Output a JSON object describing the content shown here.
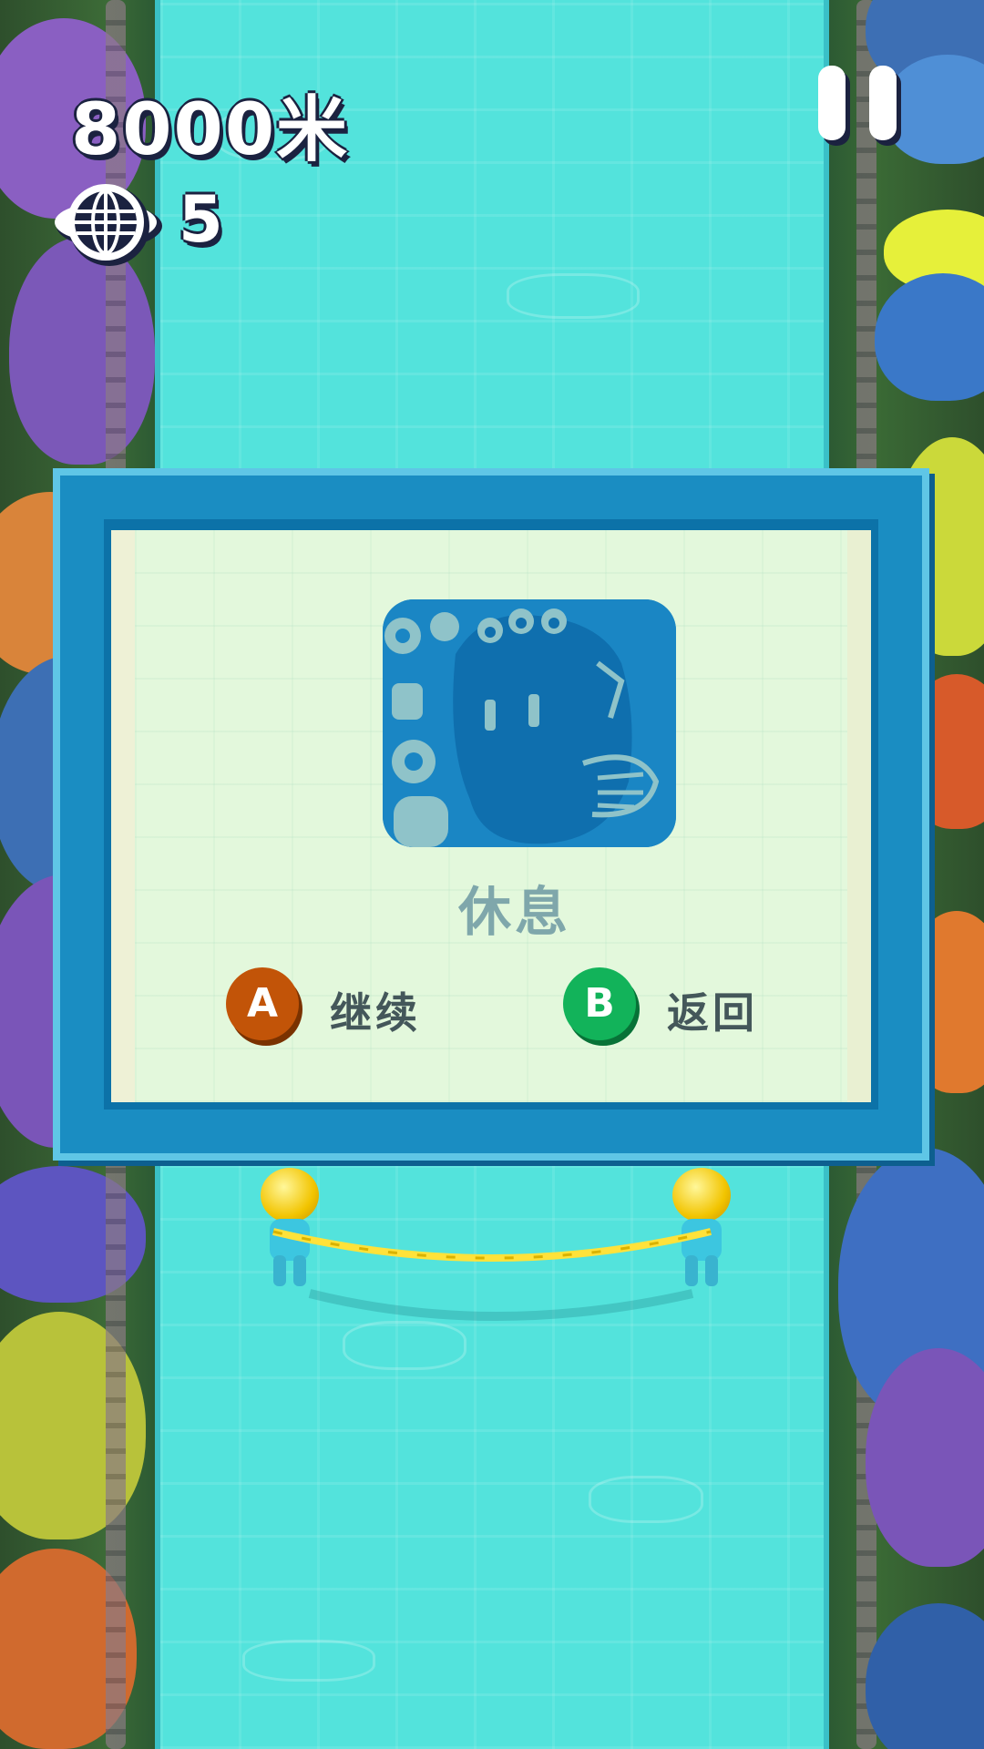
{
  "hud": {
    "distance": "8000米",
    "net_count": "5",
    "pause_icon": "pause-icon",
    "net_icon": "net-globe-icon"
  },
  "pause_dialog": {
    "title": "休息",
    "illustration": "resting-creature-illustration",
    "options": [
      {
        "key": "A",
        "label": "继续",
        "color": "#c25408"
      },
      {
        "key": "B",
        "label": "返回",
        "color": "#12b35a"
      }
    ]
  },
  "colors": {
    "river": "#53e3dc",
    "dialog_frame": "#1a8dc2",
    "dialog_panel": "#e3f8dc",
    "title_text": "#7fa7ab"
  }
}
